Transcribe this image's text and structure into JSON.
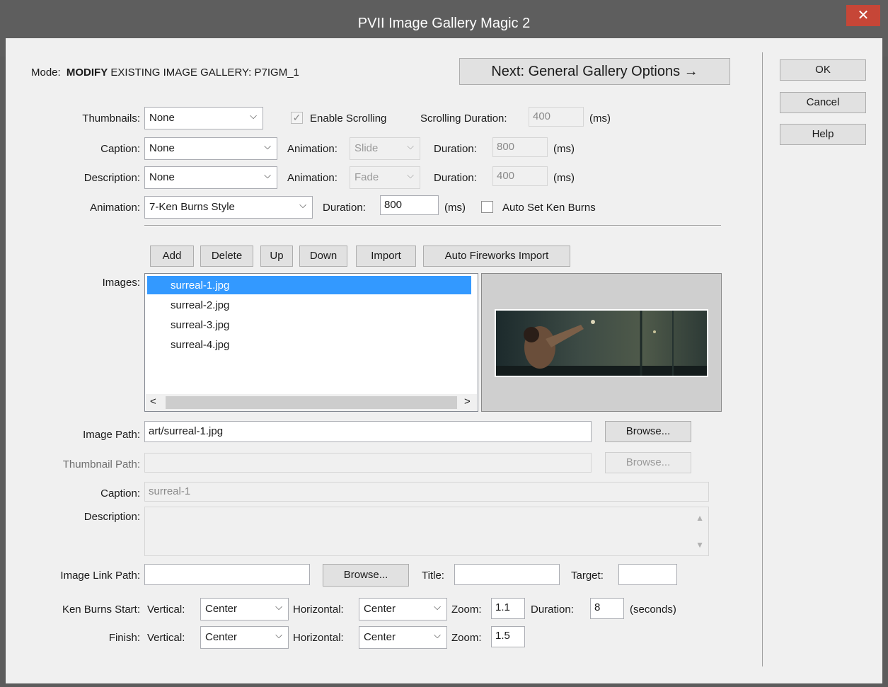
{
  "window": {
    "title": "PVII Image Gallery Magic 2",
    "close_glyph": "✕"
  },
  "mode": {
    "prefix": "Mode:",
    "bold": "MODIFY",
    "rest": "EXISTING IMAGE GALLERY: P7IGM_1"
  },
  "next_button": "Next: General Gallery Options →",
  "side_buttons": {
    "ok": "OK",
    "cancel": "Cancel",
    "help": "Help"
  },
  "thumbnails": {
    "label": "Thumbnails:",
    "value": "None",
    "enable_scrolling": {
      "label": "Enable Scrolling",
      "checked": true
    },
    "scrolling_duration": {
      "label": "Scrolling Duration:",
      "value": "400",
      "unit": "(ms)"
    }
  },
  "caption": {
    "label": "Caption:",
    "value": "None",
    "animation_label": "Animation:",
    "animation_value": "Slide",
    "duration_label": "Duration:",
    "duration_value": "800",
    "unit": "(ms)"
  },
  "description": {
    "label": "Description:",
    "value": "None",
    "animation_label": "Animation:",
    "animation_value": "Fade",
    "duration_label": "Duration:",
    "duration_value": "400",
    "unit": "(ms)"
  },
  "animation": {
    "label": "Animation:",
    "value": "7-Ken Burns Style",
    "duration_label": "Duration:",
    "duration_value": "800",
    "unit": "(ms)",
    "auto_set": {
      "label": "Auto Set Ken Burns",
      "checked": false
    }
  },
  "list_buttons": [
    "Add",
    "Delete",
    "Up",
    "Down",
    "Import",
    "Auto Fireworks Import"
  ],
  "images": {
    "label": "Images:",
    "items": [
      "surreal-1.jpg",
      "surreal-2.jpg",
      "surreal-3.jpg",
      "surreal-4.jpg"
    ],
    "selected_index": 0,
    "scroll_left": "<",
    "scroll_right": ">"
  },
  "image_path": {
    "label": "Image Path:",
    "value": "art/surreal-1.jpg",
    "browse": "Browse..."
  },
  "thumbnail_path": {
    "label": "Thumbnail Path:",
    "value": "",
    "browse": "Browse..."
  },
  "item_caption": {
    "label": "Caption:",
    "value": "surreal-1"
  },
  "item_description": {
    "label": "Description:",
    "value": ""
  },
  "image_link": {
    "label": "Image Link Path:",
    "value": "",
    "browse": "Browse...",
    "title_label": "Title:",
    "title_value": "",
    "target_label": "Target:",
    "target_value": ""
  },
  "ken_burns_start": {
    "label": "Ken Burns Start:",
    "vertical_label": "Vertical:",
    "vertical_value": "Center",
    "horizontal_label": "Horizontal:",
    "horizontal_value": "Center",
    "zoom_label": "Zoom:",
    "zoom_value": "1.1",
    "duration_label": "Duration:",
    "duration_value": "8",
    "unit": "(seconds)"
  },
  "ken_burns_finish": {
    "label": "Finish:",
    "vertical_label": "Vertical:",
    "vertical_value": "Center",
    "horizontal_label": "Horizontal:",
    "horizontal_value": "Center",
    "zoom_label": "Zoom:",
    "zoom_value": "1.5"
  },
  "colors": {
    "accent": "#3399ff",
    "close": "#c64637",
    "frame": "#5e5e5e"
  }
}
